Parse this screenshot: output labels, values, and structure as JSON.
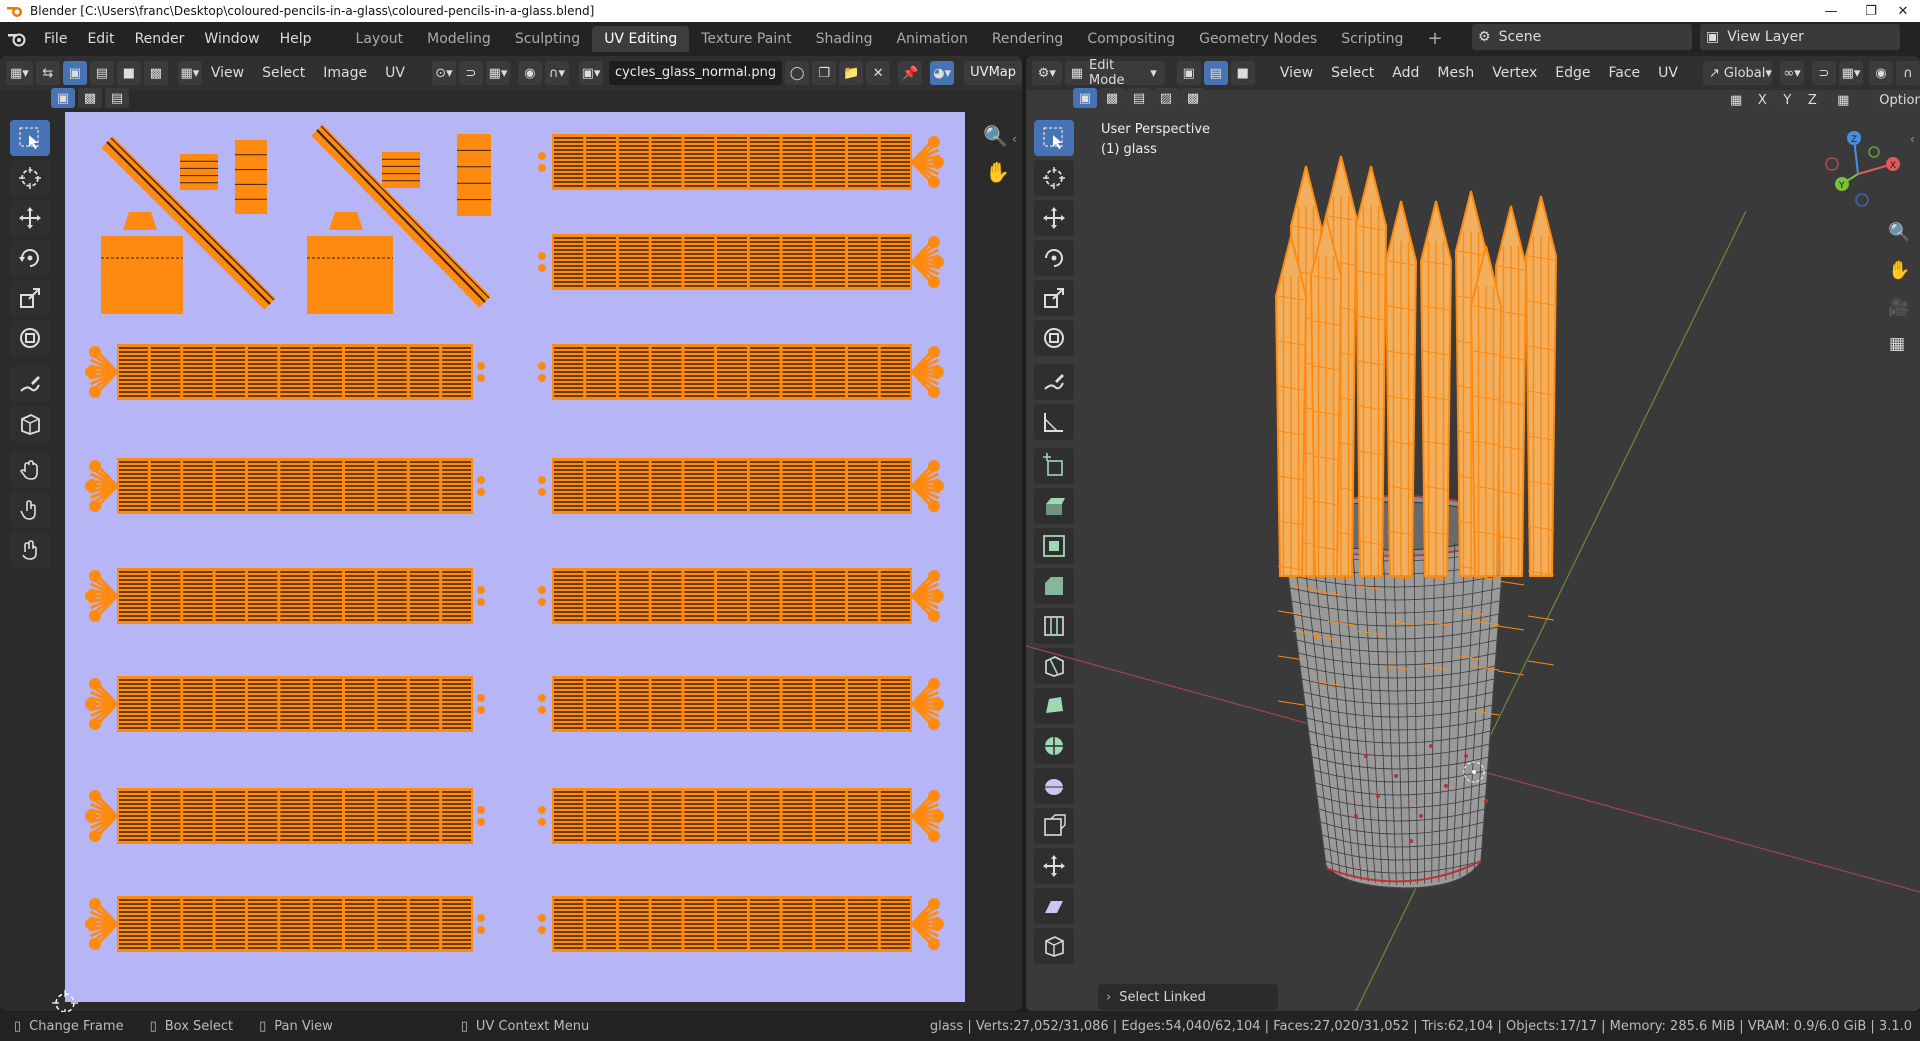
{
  "window": {
    "title": "Blender [C:\\Users\\franc\\Desktop\\coloured-pencils-in-a-glass\\coloured-pencils-in-a-glass.blend]"
  },
  "menus": [
    "File",
    "Edit",
    "Render",
    "Window",
    "Help"
  ],
  "workspaces": [
    "Layout",
    "Modeling",
    "Sculpting",
    "UV Editing",
    "Texture Paint",
    "Shading",
    "Animation",
    "Rendering",
    "Compositing",
    "Geometry Nodes",
    "Scripting"
  ],
  "active_workspace": "UV Editing",
  "scene": {
    "label": "Scene"
  },
  "view_layer": {
    "label": "View Layer"
  },
  "uv_editor": {
    "menus": [
      "View",
      "Select",
      "Image",
      "UV"
    ],
    "image_name": "cycles_glass_normal.png",
    "uvmap": "UVMap"
  },
  "viewport": {
    "mode": "Edit Mode",
    "menus": [
      "View",
      "Select",
      "Add",
      "Mesh",
      "Vertex",
      "Edge",
      "Face",
      "UV"
    ],
    "transform": "Global",
    "options": "Options",
    "perspective": "User Perspective",
    "object": "(1) glass",
    "axes": [
      "X",
      "Y",
      "Z"
    ],
    "operator_panel": "Select Linked"
  },
  "statusbar": {
    "items": [
      "Change Frame",
      "Box Select",
      "Pan View",
      "UV Context Menu"
    ],
    "stats": "glass | Verts:27,052/31,086 | Edges:54,040/62,104 | Faces:27,020/31,052 | Tris:62,104 | Objects:17/17 | Memory: 285.6 MiB | VRAM: 0.9/6.0 GiB | 3.1.0"
  },
  "colors": {
    "accent": "#4772b3",
    "uv_bg": "#b6b6f7",
    "selected": "#ff8a10",
    "header": "#303030"
  }
}
